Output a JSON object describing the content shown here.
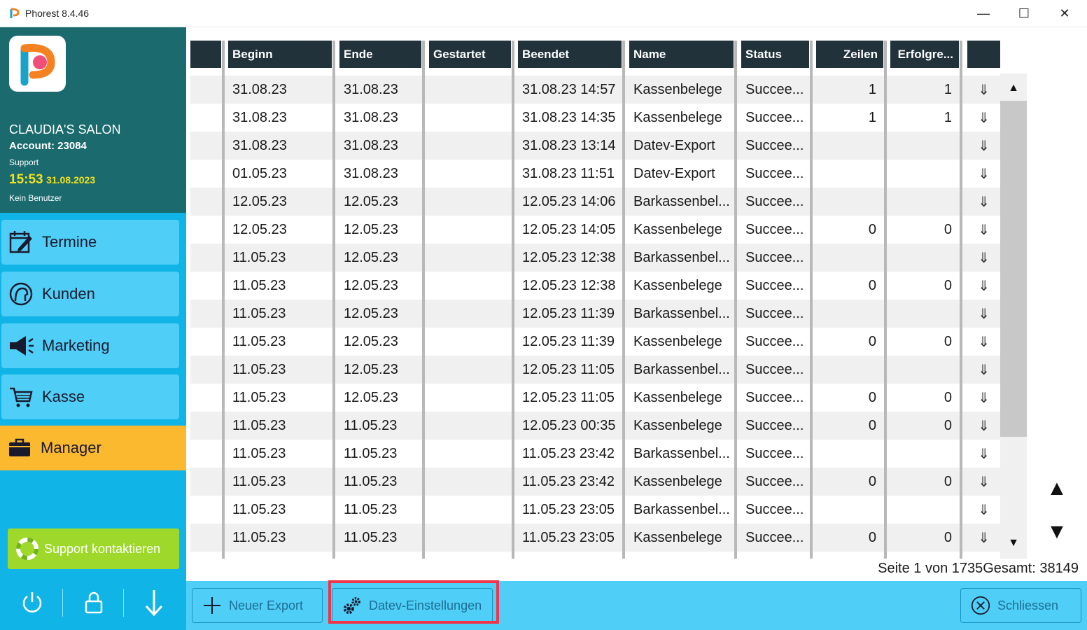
{
  "window": {
    "title": "Phorest 8.4.46",
    "minimize_glyph": "—",
    "maximize_glyph": "☐",
    "close_glyph": "✕"
  },
  "sidebar": {
    "salon_name": "CLAUDIA'S SALON",
    "account": "Account: 23084",
    "support_label": "Support",
    "time": "15:53",
    "date": "31.08.2023",
    "user": "Kein Benutzer",
    "nav": [
      {
        "label": "Termine",
        "icon": "calendar-edit-icon"
      },
      {
        "label": "Kunden",
        "icon": "person-head-icon"
      },
      {
        "label": "Marketing",
        "icon": "megaphone-icon"
      },
      {
        "label": "Kasse",
        "icon": "shopping-cart-icon"
      },
      {
        "label": "Manager",
        "icon": "briefcase-icon",
        "active": true
      }
    ],
    "support_button": "Support kontaktieren",
    "bottom_icons": [
      "power-icon",
      "lock-icon",
      "arrow-down-icon"
    ]
  },
  "table": {
    "columns": [
      "",
      "Beginn",
      "Ende",
      "Gestartet",
      "Beendet",
      "Name",
      "Status",
      "Zeilen",
      "Erfolgre...",
      ""
    ],
    "rows": [
      [
        "31.08.23",
        "31.08.23",
        "",
        "31.08.23 14:57",
        "Kassenbelege",
        "Succee...",
        "1",
        "1"
      ],
      [
        "31.08.23",
        "31.08.23",
        "",
        "31.08.23 14:35",
        "Kassenbelege",
        "Succee...",
        "1",
        "1"
      ],
      [
        "31.08.23",
        "31.08.23",
        "",
        "31.08.23 13:14",
        "Datev-Export",
        "Succee...",
        "",
        ""
      ],
      [
        "01.05.23",
        "31.08.23",
        "",
        "31.08.23 11:51",
        "Datev-Export",
        "Succee...",
        "",
        ""
      ],
      [
        "12.05.23",
        "12.05.23",
        "",
        "12.05.23 14:06",
        "Barkassenbel...",
        "Succee...",
        "",
        ""
      ],
      [
        "12.05.23",
        "12.05.23",
        "",
        "12.05.23 14:05",
        "Kassenbelege",
        "Succee...",
        "0",
        "0"
      ],
      [
        "11.05.23",
        "12.05.23",
        "",
        "12.05.23 12:38",
        "Barkassenbel...",
        "Succee...",
        "",
        ""
      ],
      [
        "11.05.23",
        "12.05.23",
        "",
        "12.05.23 12:38",
        "Kassenbelege",
        "Succee...",
        "0",
        "0"
      ],
      [
        "11.05.23",
        "12.05.23",
        "",
        "12.05.23 11:39",
        "Barkassenbel...",
        "Succee...",
        "",
        ""
      ],
      [
        "11.05.23",
        "12.05.23",
        "",
        "12.05.23 11:39",
        "Kassenbelege",
        "Succee...",
        "0",
        "0"
      ],
      [
        "11.05.23",
        "12.05.23",
        "",
        "12.05.23 11:05",
        "Barkassenbel...",
        "Succee...",
        "",
        ""
      ],
      [
        "11.05.23",
        "12.05.23",
        "",
        "12.05.23 11:05",
        "Kassenbelege",
        "Succee...",
        "0",
        "0"
      ],
      [
        "11.05.23",
        "11.05.23",
        "",
        "12.05.23 00:35",
        "Kassenbelege",
        "Succee...",
        "0",
        "0"
      ],
      [
        "11.05.23",
        "11.05.23",
        "",
        "11.05.23 23:42",
        "Barkassenbel...",
        "Succee...",
        "",
        ""
      ],
      [
        "11.05.23",
        "11.05.23",
        "",
        "11.05.23 23:42",
        "Kassenbelege",
        "Succee...",
        "0",
        "0"
      ],
      [
        "11.05.23",
        "11.05.23",
        "",
        "11.05.23 23:05",
        "Barkassenbel...",
        "Succee...",
        "",
        ""
      ],
      [
        "11.05.23",
        "11.05.23",
        "",
        "11.05.23 23:05",
        "Kassenbelege",
        "Succee...",
        "0",
        "0"
      ]
    ],
    "download_glyph": "⇓"
  },
  "pager": {
    "text": "Seite 1 von 1735Gesamt: 38149"
  },
  "scroll": {
    "up_glyph": "▲",
    "down_glyph": "▼",
    "page_up_glyph": "▲",
    "page_down_glyph": "▼"
  },
  "toolbar": {
    "new_export": "Neuer Export",
    "datev_settings": "Datev-Einstellungen",
    "close": "Schliessen"
  },
  "colors": {
    "sidebar_header": "#1a6a6e",
    "sidebar_bg": "#10b4e6",
    "nav_item": "#4fcff7",
    "nav_active": "#fbb930",
    "support_green": "#9dd82a",
    "table_header": "#21323b",
    "highlight_red": "#f0354a"
  }
}
